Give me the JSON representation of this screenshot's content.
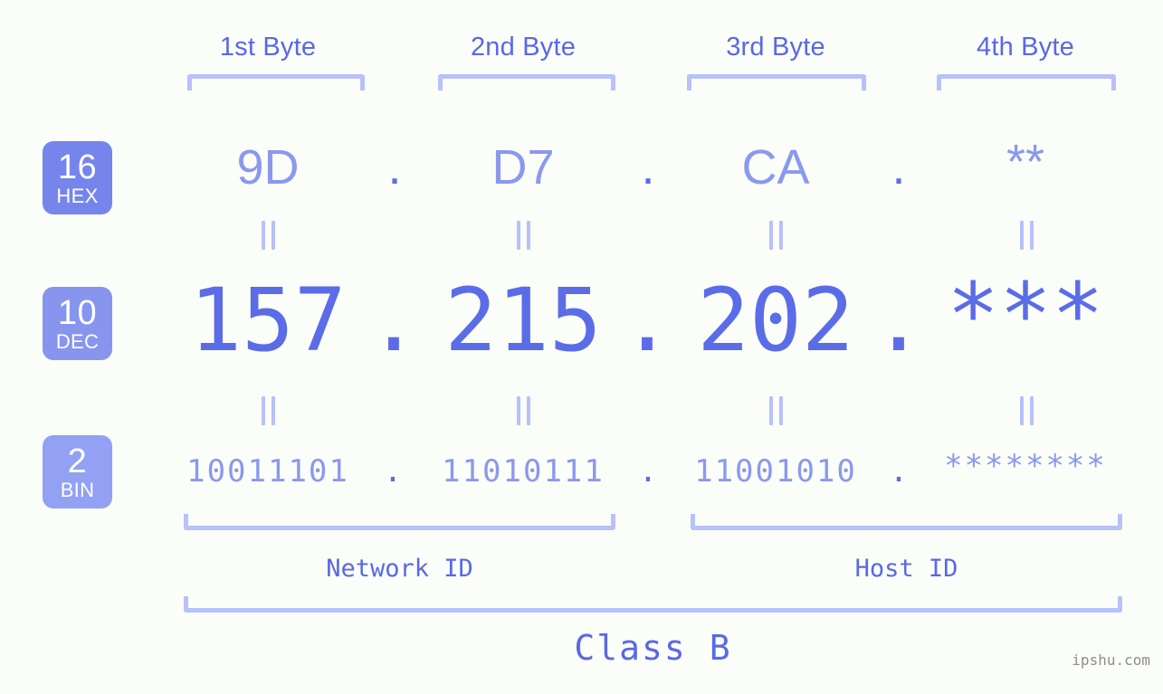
{
  "meta": {
    "background_color": "#fbfdf8",
    "accent_color": "#5a6ce8",
    "light_accent_color": "#8a98ee",
    "bracket_color": "#b7c1fa"
  },
  "byte_headers": [
    {
      "label": "1st Byte"
    },
    {
      "label": "2nd Byte"
    },
    {
      "label": "3rd Byte"
    },
    {
      "label": "4th Byte"
    }
  ],
  "rows": [
    {
      "key": "hex",
      "badge": {
        "base": "16",
        "abbr": "HEX",
        "color": "#7585ec"
      },
      "values": [
        "9D",
        "D7",
        "CA",
        "**"
      ],
      "separator": "."
    },
    {
      "key": "dec",
      "badge": {
        "base": "10",
        "abbr": "DEC",
        "color": "#8795ef"
      },
      "values": [
        "157",
        "215",
        "202",
        "***"
      ],
      "separator": "."
    },
    {
      "key": "bin",
      "badge": {
        "base": "2",
        "abbr": "BIN",
        "color": "#92a1f4"
      },
      "values": [
        "10011101",
        "11010111",
        "11001010",
        "********"
      ],
      "separator": "."
    }
  ],
  "id_sections": [
    {
      "label": "Network ID"
    },
    {
      "label": "Host ID"
    }
  ],
  "class": {
    "label": "Class B"
  },
  "watermark": {
    "text": "ipshu.com"
  }
}
